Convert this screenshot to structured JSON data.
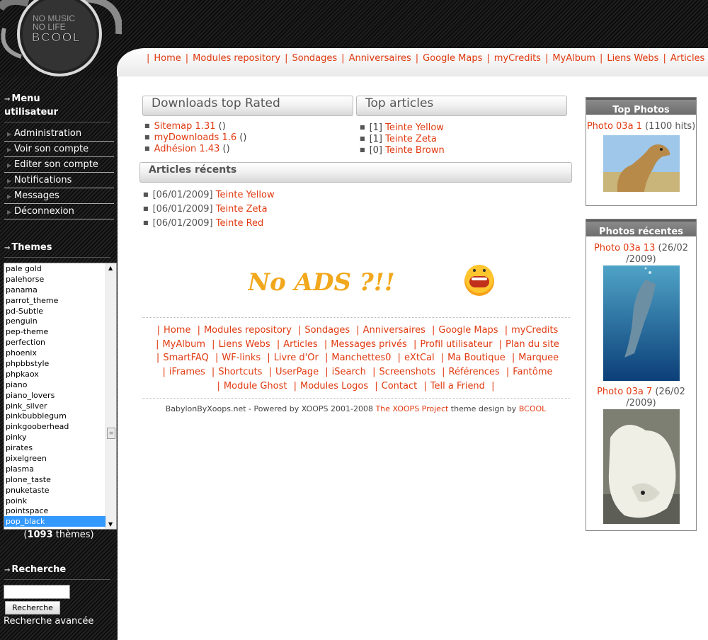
{
  "logo": {
    "line1": "NO MUSIC",
    "line2": "NO LIFE",
    "brand": "BCOOL"
  },
  "nav": {
    "items": [
      "Home",
      "Modules repository",
      "Sondages",
      "Anniversaires",
      "Google Maps",
      "myCredits",
      "MyAlbum",
      "Liens Webs",
      "Articles"
    ]
  },
  "sidebar": {
    "menu_title_1": "Menu",
    "menu_title_2": "utilisateur",
    "menu_items": [
      "Administration",
      "Voir son compte",
      "Editer son compte",
      "Notifications",
      "Messages",
      "Déconnexion"
    ],
    "themes_title": "Themes",
    "themes": [
      "pale gold",
      "palehorse",
      "panama",
      "parrot_theme",
      "pd-Subtle",
      "penguin",
      "pep-theme",
      "perfection",
      "phoenix",
      "phpbbstyle",
      "phpkaox",
      "piano",
      "piano_lovers",
      "pink_silver",
      "pinkbubblegum",
      "pinkgooberhead",
      "pinky",
      "pirates",
      "pixelgreen",
      "plasma",
      "plone_taste",
      "pnuketaste",
      "poink",
      "pointspace",
      "pop_black"
    ],
    "selected_theme": "pop_black",
    "themes_count_open": "(",
    "themes_count": "1093",
    "themes_count_suffix": " thèmes)",
    "search_title": "Recherche",
    "search_value": "",
    "search_button": "Recherche",
    "advanced_search": "Recherche avancée"
  },
  "downloads": {
    "title": "Downloads top Rated",
    "items": [
      {
        "name": "Sitemap 1.31",
        "count": " ()"
      },
      {
        "name": "myDownloads 1.6",
        "count": " ()"
      },
      {
        "name": "Adhésion 1.43",
        "count": " ()"
      }
    ]
  },
  "top_articles": {
    "title": "Top articles",
    "items": [
      {
        "count": "[1] ",
        "name": "Teinte Yellow"
      },
      {
        "count": "[1] ",
        "name": "Teinte Zeta"
      },
      {
        "count": "[0] ",
        "name": "Teinte Brown"
      }
    ]
  },
  "recent_articles": {
    "title": "Articles récents",
    "items": [
      {
        "date": "[06/01/2009] ",
        "name": "Teinte Yellow"
      },
      {
        "date": "[06/01/2009] ",
        "name": "Teinte Zeta"
      },
      {
        "date": "[06/01/2009] ",
        "name": "Teinte Red"
      }
    ]
  },
  "banner": {
    "text": "No ADS ?!!"
  },
  "footer_nav": [
    "Home",
    "Modules repository",
    "Sondages",
    "Anniversaires",
    "Google Maps",
    "myCredits",
    "MyAlbum",
    "Liens Webs",
    "Articles",
    "Messages privés",
    "Profil utilisateur",
    "Plan du site",
    "SmartFAQ",
    "WF-links",
    "Livre d'Or",
    "Manchettes0",
    "eXtCal",
    "Ma Boutique",
    "Marquee",
    "iFrames",
    "Shortcuts",
    "UserPage",
    "iSearch",
    "Screenshots",
    "Références",
    "Fantôme",
    "Module Ghost",
    "Modules Logos",
    "Contact",
    "Tell a Friend"
  ],
  "credits": {
    "prefix": "BabylonByXoops.net - Powered by XOOPS 2001-2008 ",
    "project": "The XOOPS Project",
    "middle": " theme design by ",
    "designer": "BCOOL"
  },
  "top_photos": {
    "title": "Top Photos",
    "photo_link": "Photo 03a 1",
    "photo_meta": " (1100 hits)"
  },
  "recent_photos": {
    "title": "Photos récentes",
    "photo1_link": "Photo 03a 13",
    "photo1_meta": " (26/02 /2009)",
    "photo2_link": "Photo 03a 7",
    "photo2_meta": " (26/02 /2009)"
  },
  "colors": {
    "link": "#e03a10",
    "selection": "#3399ff",
    "sidebar_bg": "#1a1a1a"
  }
}
